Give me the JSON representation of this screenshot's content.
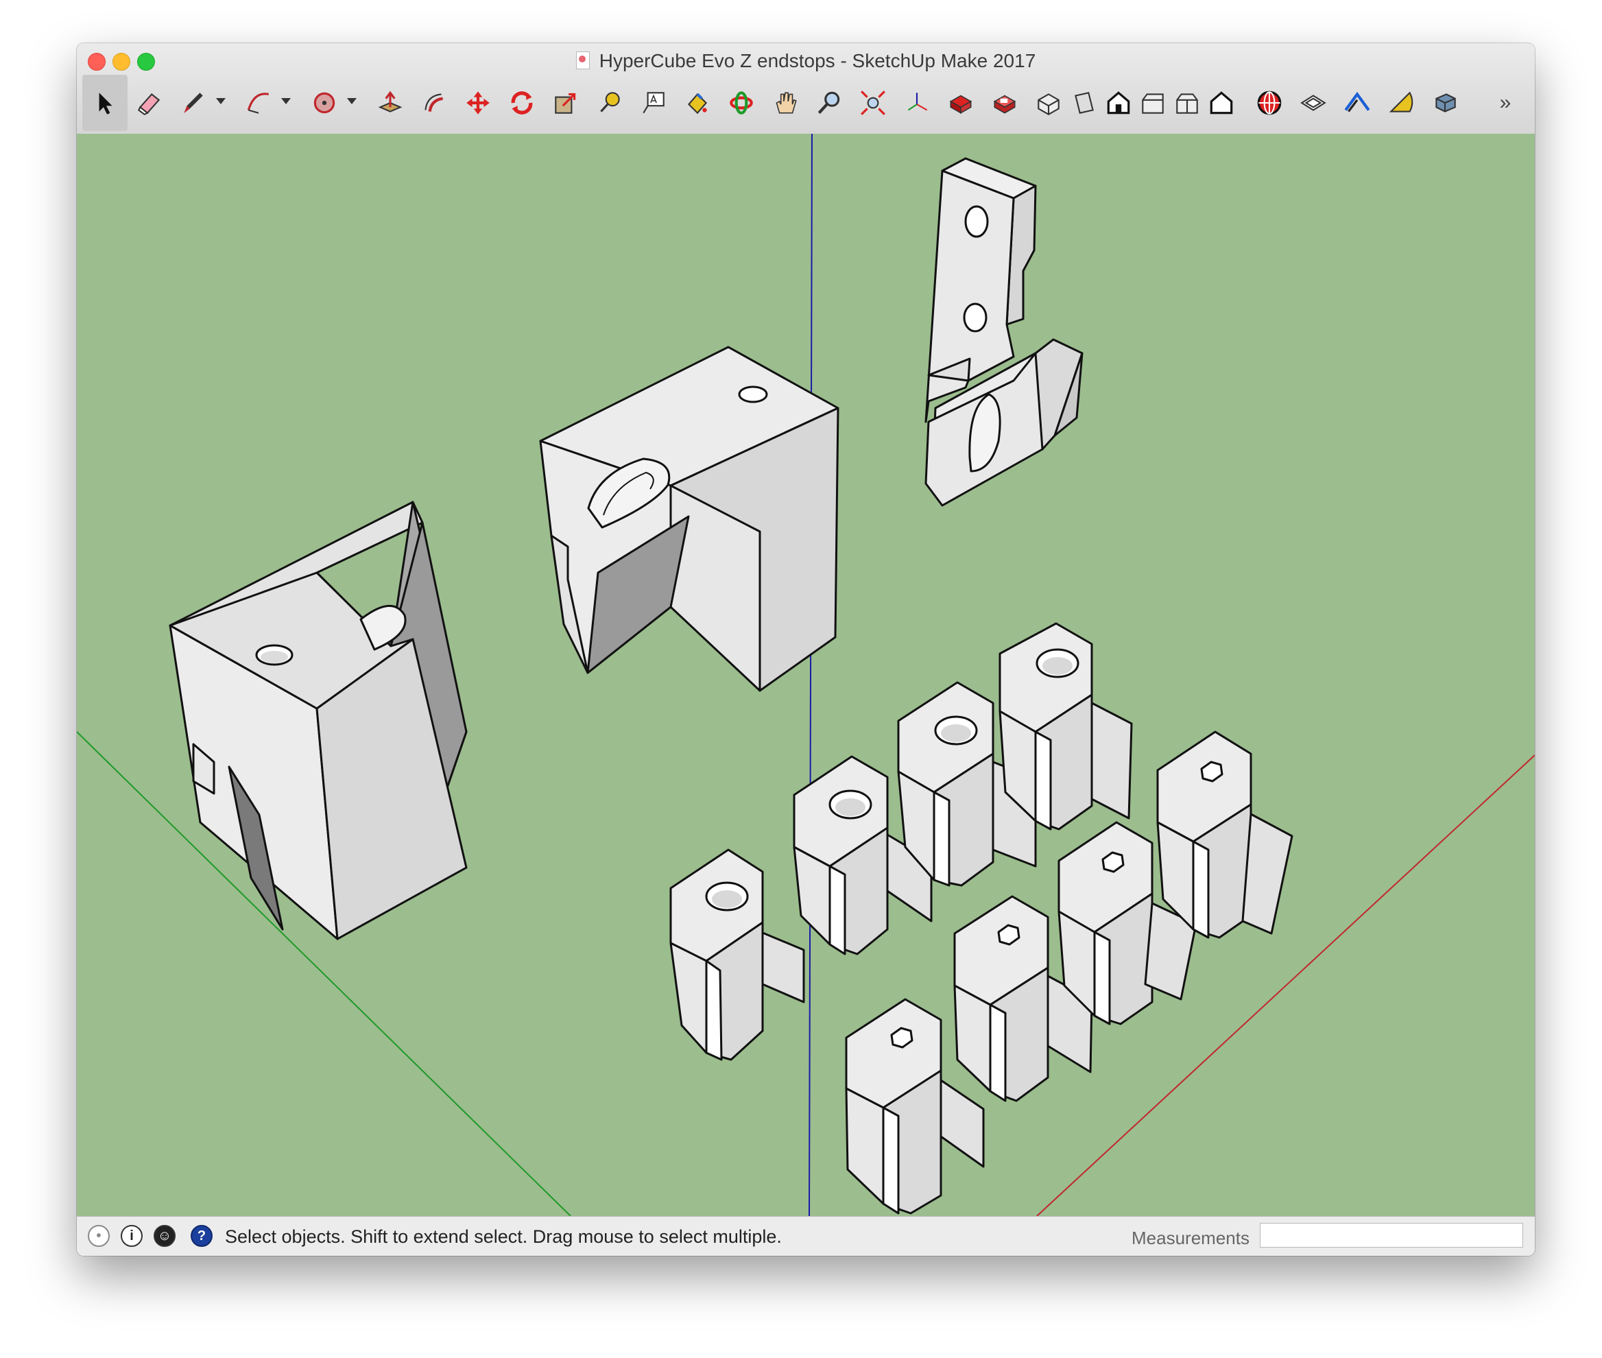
{
  "window": {
    "title": "HyperCube Evo Z endstops - SketchUp Make 2017"
  },
  "toolbar": {
    "tools": [
      {
        "name": "select-tool-icon",
        "active": true
      },
      {
        "name": "eraser-tool-icon"
      },
      {
        "name": "line-tool-icon",
        "dropdown": true
      },
      {
        "name": "arc-tool-icon",
        "dropdown": true
      },
      {
        "name": "shape-tool-icon",
        "dropdown": true
      },
      {
        "name": "push-pull-tool-icon"
      },
      {
        "name": "offset-tool-icon"
      },
      {
        "name": "move-tool-icon"
      },
      {
        "name": "rotate-tool-icon"
      },
      {
        "name": "scale-tool-icon"
      },
      {
        "name": "tape-measure-tool-icon"
      },
      {
        "name": "text-tool-icon"
      },
      {
        "name": "paint-bucket-tool-icon"
      },
      {
        "name": "orbit-tool-icon"
      },
      {
        "name": "pan-tool-icon"
      },
      {
        "name": "zoom-tool-icon"
      },
      {
        "name": "zoom-extents-tool-icon"
      },
      {
        "name": "axes-tool-icon"
      },
      {
        "name": "3d-warehouse-icon"
      },
      {
        "name": "extension-warehouse-icon"
      },
      {
        "name": "iso-view-icon"
      },
      {
        "name": "top-view-icon"
      },
      {
        "name": "front-view-icon"
      },
      {
        "name": "right-view-icon"
      },
      {
        "name": "back-view-icon"
      },
      {
        "name": "left-view-icon"
      },
      {
        "name": "geo-location-icon"
      },
      {
        "name": "section-plane-icon"
      },
      {
        "name": "walk-tool-icon"
      },
      {
        "name": "protractor-tool-icon"
      },
      {
        "name": "solid-tools-icon"
      }
    ],
    "overflow_label": "»"
  },
  "viewport": {
    "background_color": "#9cbd8e",
    "axis_colors": {
      "red": "#c0272d",
      "green": "#1e9a2a",
      "blue": "#1a1aa8"
    }
  },
  "statusbar": {
    "icons": [
      "geo-location-status-icon",
      "credits-status-icon",
      "account-status-icon",
      "help-status-icon"
    ],
    "info_glyph": "i",
    "help_glyph": "?",
    "message": "Select objects. Shift to extend select. Drag mouse to select multiple.",
    "measurements_label": "Measurements",
    "measurements_value": ""
  }
}
